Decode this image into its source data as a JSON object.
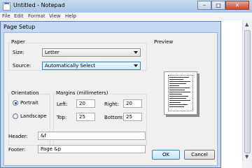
{
  "notepad": {
    "title": "Untitled - Notepad",
    "controls": {
      "minimize": "–",
      "maximize": "□",
      "close": "✕"
    },
    "menu": [
      "File",
      "Edit",
      "Format",
      "View",
      "Help"
    ],
    "scroll_up": "▲",
    "scroll_down": "▼"
  },
  "dialog": {
    "title": "Page Setup",
    "paper": {
      "group_label": "Paper",
      "size_label": "Size:",
      "size_value": "Letter",
      "source_label": "Source:",
      "source_value": "Automatically Select"
    },
    "orientation": {
      "group_label": "Orientation",
      "portrait_label": "Portrait",
      "landscape_label": "Landscape",
      "selected": "Portrait"
    },
    "margins": {
      "group_label": "Margins (millimeters)",
      "left_label": "Left:",
      "left_value": "20",
      "right_label": "Right:",
      "right_value": "20",
      "top_label": "Top:",
      "top_value": "25",
      "bottom_label": "Bottom:",
      "bottom_value": "25"
    },
    "preview_label": "Preview",
    "header_label": "Header:",
    "header_value": "&f",
    "footer_label": "Footer:",
    "footer_value": "Page &p",
    "ok_label": "OK",
    "cancel_label": "Cancel"
  }
}
